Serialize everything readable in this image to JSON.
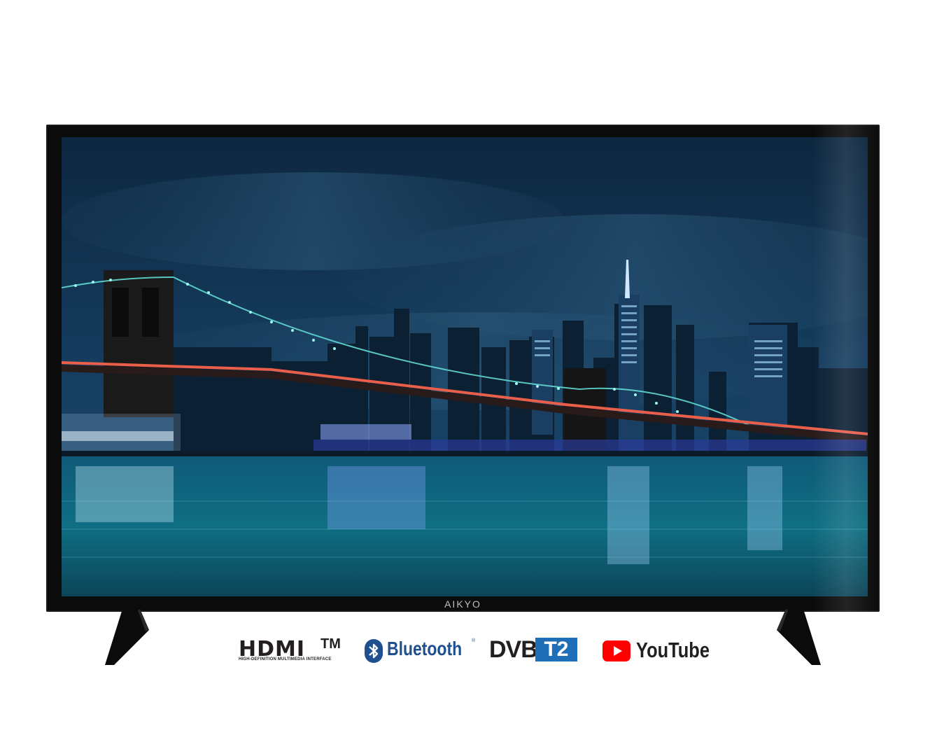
{
  "tv": {
    "brand": "AIKYO",
    "screen_scene": "night-city-skyline-bridge"
  },
  "logos": {
    "hdmi": {
      "main": "HDMI",
      "tm": "TM",
      "subtitle": "HIGH-DEFINITION MULTIMEDIA INTERFACE"
    },
    "bluetooth": {
      "label": "Bluetooth",
      "reg": "®",
      "color": "#1f4f8f"
    },
    "dvb": {
      "main": "DVB",
      "badge": "T2",
      "badge_color": "#1e6fb8"
    },
    "youtube": {
      "label": "YouTube",
      "icon_color": "#ff0000"
    }
  }
}
